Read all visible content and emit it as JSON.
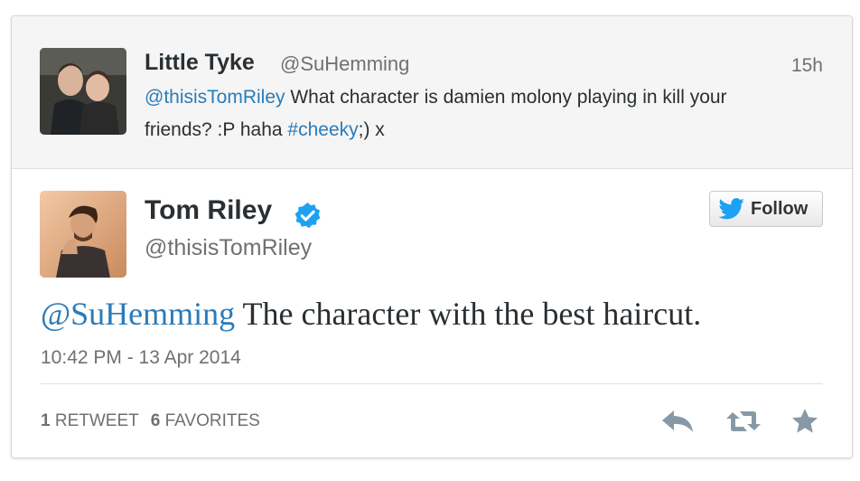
{
  "reply_tweet": {
    "author_name": "Little Tyke",
    "author_handle": "@SuHemming",
    "time": "15h",
    "mention": "@thisisTomRiley",
    "text_part1": " What character is damien molony playing in kill your friends? :P haha ",
    "hashtag": "#cheeky",
    "text_part2": ";) x"
  },
  "main_tweet": {
    "author_name": "Tom Riley",
    "author_handle": "@thisisTomRiley",
    "verified": true,
    "mention": "@SuHemming",
    "text": " The character with the best haircut.",
    "datetime": "10:42 PM - 13 Apr 2014"
  },
  "follow_button": {
    "label": "Follow"
  },
  "stats": {
    "retweets_count": "1",
    "retweets_label": "RETWEET",
    "favorites_count": "6",
    "favorites_label": "FAVORITES"
  },
  "icons": {
    "reply": "reply-icon",
    "retweet": "retweet-icon",
    "favorite": "star-icon",
    "follow_bird": "twitter-bird-icon",
    "verified": "verified-badge-icon"
  },
  "colors": {
    "link": "#2b7bb9",
    "verified_blue": "#1da1f2",
    "muted": "#707070",
    "action_icon": "#8899a6"
  }
}
